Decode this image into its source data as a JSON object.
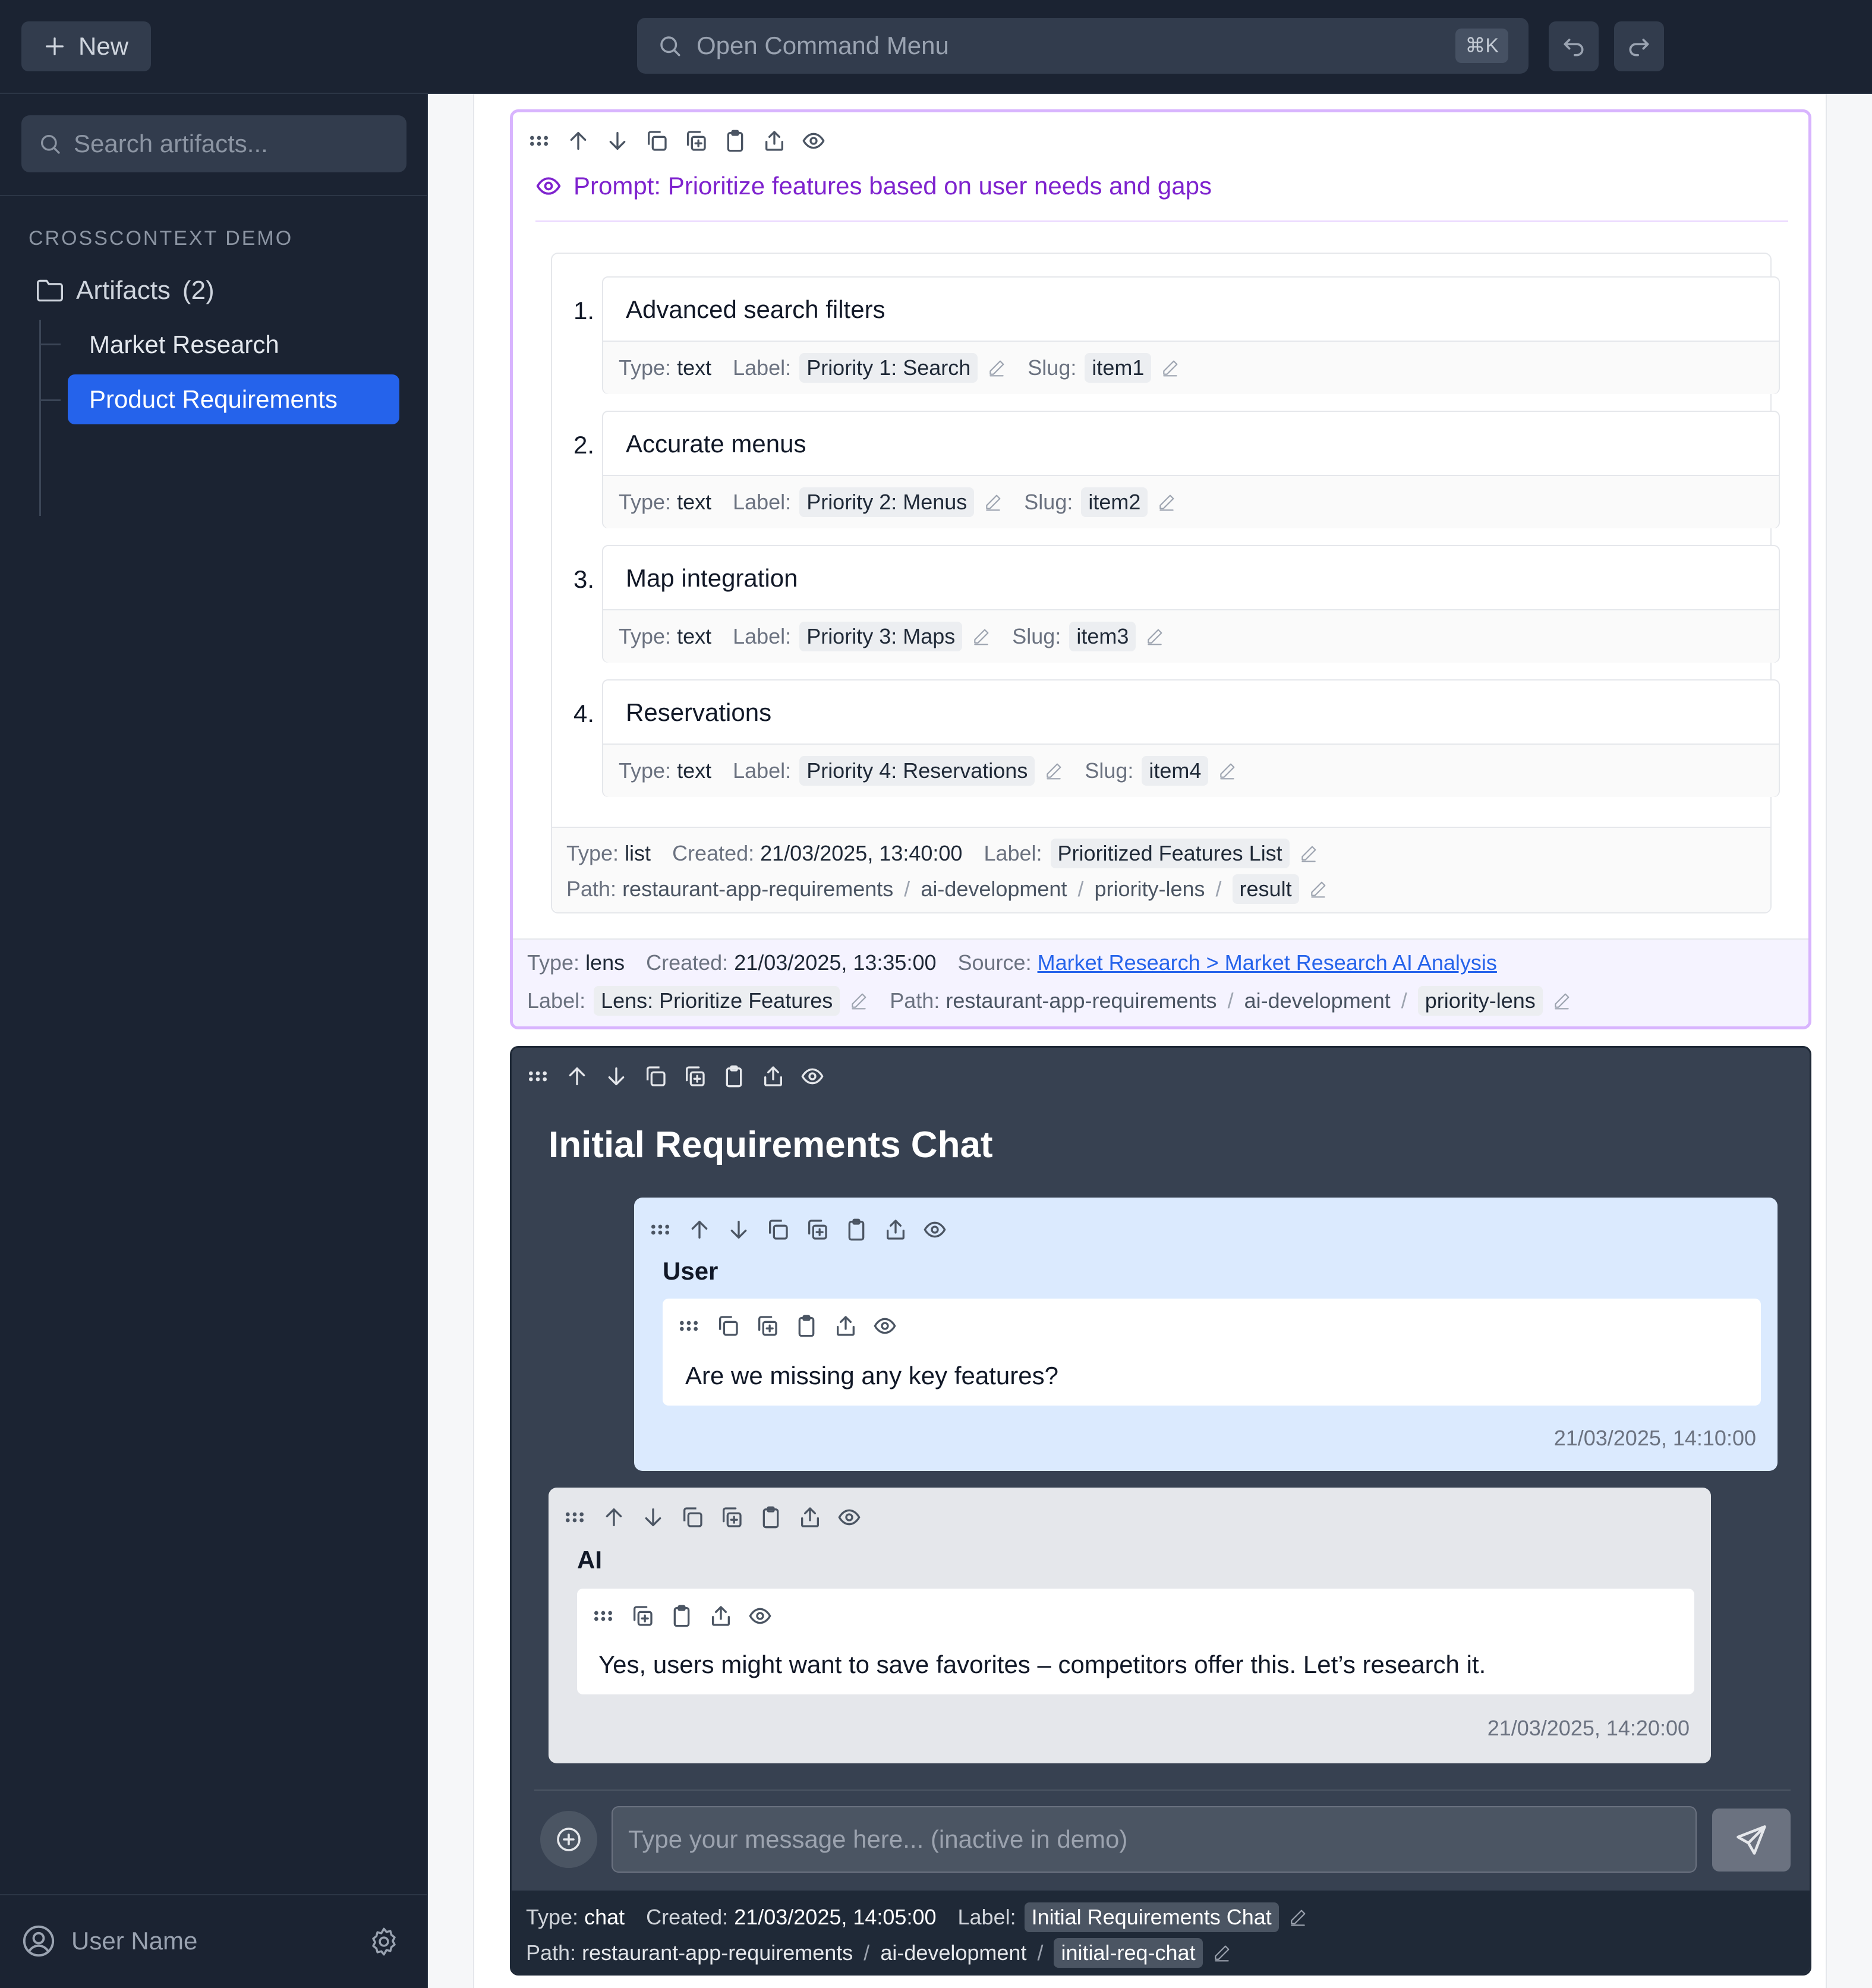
{
  "topbar": {
    "new_label": "New",
    "command_placeholder": "Open Command Menu",
    "shortcut": "⌘K"
  },
  "sidebar": {
    "search_placeholder": "Search artifacts...",
    "section_title": "CROSSCONTEXT DEMO",
    "folder_label": "Artifacts",
    "folder_count": "(2)",
    "items": [
      {
        "label": "Market Research",
        "active": false
      },
      {
        "label": "Product Requirements",
        "active": true
      }
    ],
    "user_name": "User Name"
  },
  "lens": {
    "prompt": "Prompt: Prioritize features based on user needs and gaps",
    "items": [
      {
        "num": "1.",
        "text": "Advanced search filters",
        "type": "text",
        "label": "Priority 1: Search",
        "slug": "item1"
      },
      {
        "num": "2.",
        "text": "Accurate menus",
        "type": "text",
        "label": "Priority 2: Menus",
        "slug": "item2"
      },
      {
        "num": "3.",
        "text": "Map integration",
        "type": "text",
        "label": "Priority 3: Maps",
        "slug": "item3"
      },
      {
        "num": "4.",
        "text": "Reservations",
        "type": "text",
        "label": "Priority 4: Reservations",
        "slug": "item4"
      }
    ],
    "list_meta": {
      "type": "list",
      "created": "21/03/2025, 13:40:00",
      "label": "Prioritized Features List",
      "path": [
        "restaurant-app-requirements",
        "ai-development",
        "priority-lens"
      ],
      "slug": "result"
    },
    "meta": {
      "type": "lens",
      "created": "21/03/2025, 13:35:00",
      "source": "Market Research > Market Research AI Analysis",
      "label": "Lens: Prioritize Features",
      "path": [
        "restaurant-app-requirements",
        "ai-development"
      ],
      "slug": "priority-lens"
    }
  },
  "chat": {
    "title": "Initial Requirements Chat",
    "messages": [
      {
        "role": "User",
        "text": "Are we missing any key features?",
        "time": "21/03/2025, 14:10:00"
      },
      {
        "role": "AI",
        "text": "Yes, users might want to save favorites – competitors offer this. Let’s research it.",
        "time": "21/03/2025, 14:20:00"
      }
    ],
    "input_placeholder": "Type your message here... (inactive in demo)",
    "meta": {
      "type": "chat",
      "created": "21/03/2025, 14:05:00",
      "label": "Initial Requirements Chat",
      "path": [
        "restaurant-app-requirements",
        "ai-development"
      ],
      "slug": "initial-req-chat"
    }
  },
  "strings": {
    "type": "Type:",
    "label": "Label:",
    "slug": "Slug:",
    "created": "Created:",
    "path": "Path:",
    "source": "Source:",
    "sep": "/"
  },
  "colors": {
    "accent": "#2563eb",
    "lens_border": "#d8b4fe",
    "prompt_text": "#7e22ce",
    "chat_bg": "#374151",
    "user_bubble": "#dbeafe",
    "ai_bubble": "#e5e7eb"
  }
}
